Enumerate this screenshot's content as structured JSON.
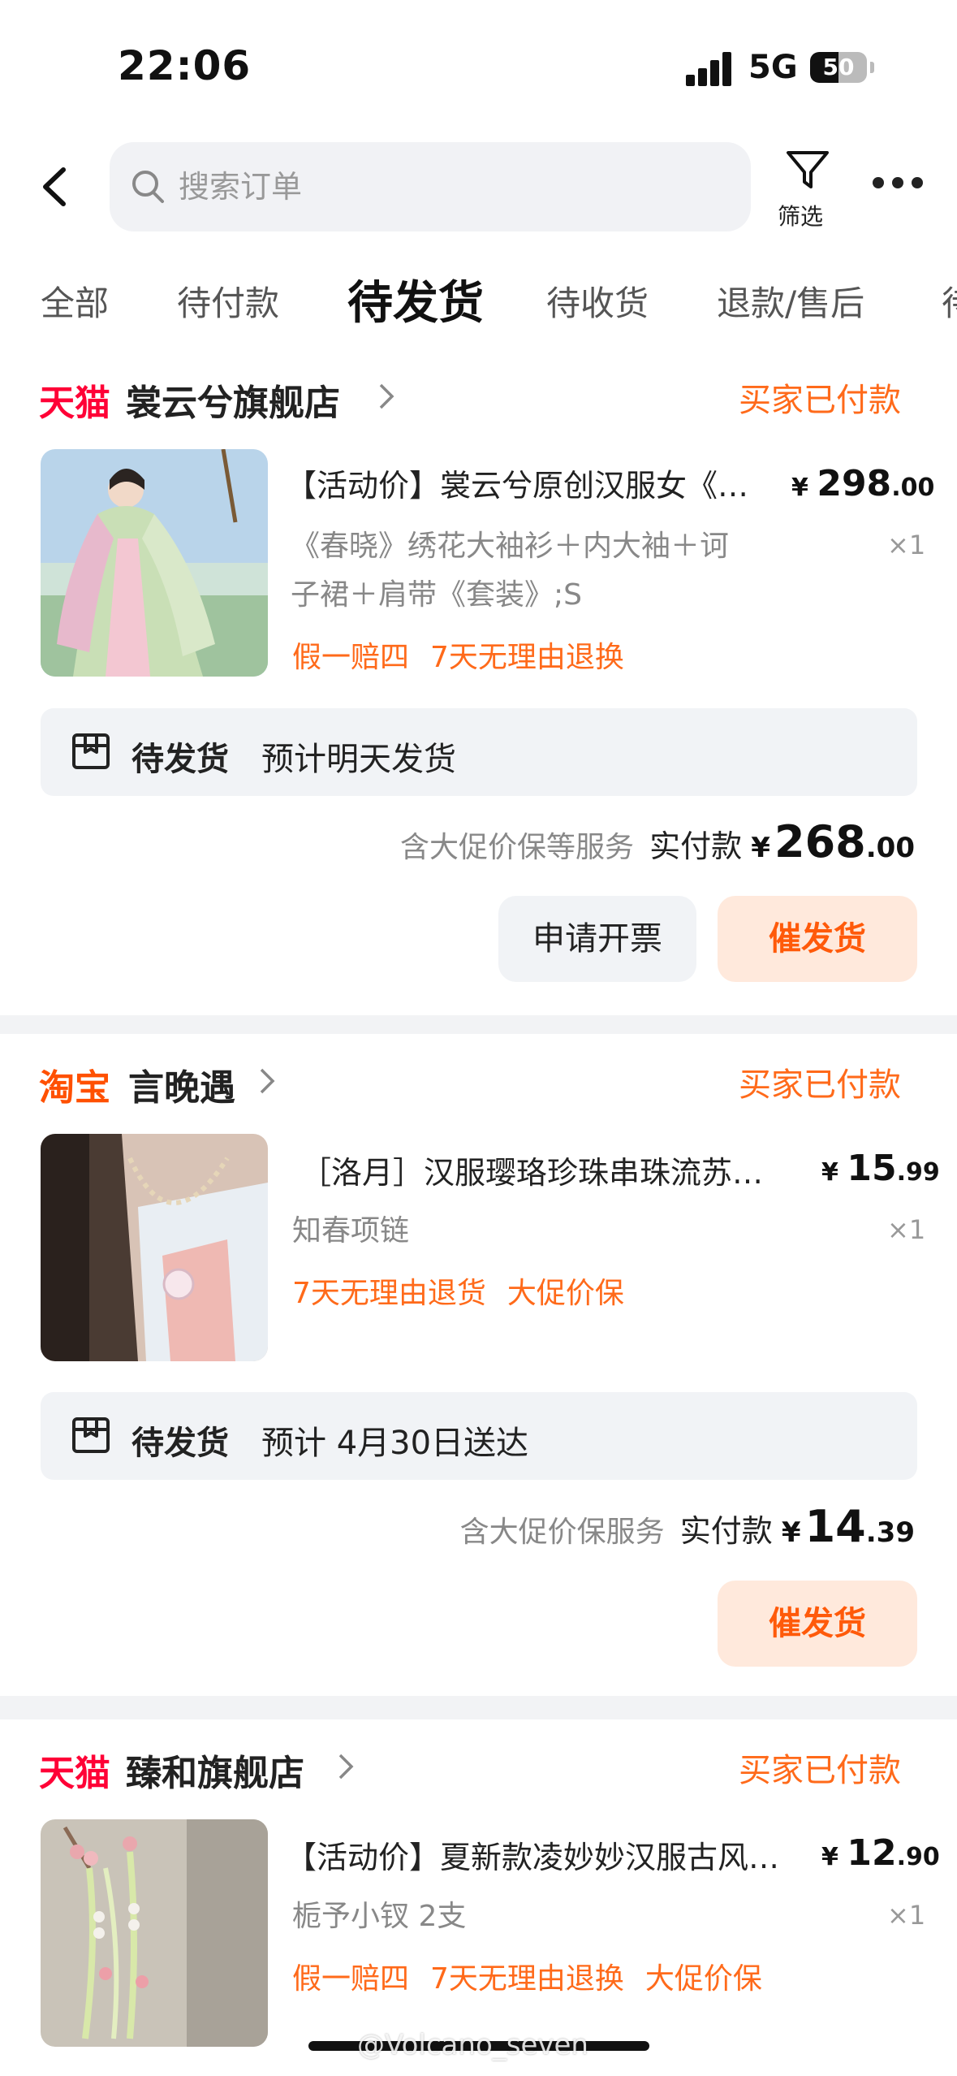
{
  "status_bar": {
    "time": "22:06",
    "network": "5G",
    "battery": "50"
  },
  "header": {
    "search_placeholder": "搜索订单",
    "filter_label": "筛选"
  },
  "tabs": [
    "全部",
    "待付款",
    "待发货",
    "待收货",
    "退款/售后",
    "待"
  ],
  "active_tab": "待发货",
  "orders": [
    {
      "platform": "天猫",
      "store": "裳云兮旗舰店",
      "status": "买家已付款",
      "title": "【活动价】裳云兮原创汉服女《…",
      "price_yen": "¥",
      "price_int": "298",
      "price_dec": ".00",
      "sku_line1": "《春晓》绣花大袖衫＋内大袖＋诃",
      "sku_line2": "子裙＋肩带《套装》;S",
      "qty": "×1",
      "tags": [
        "假一赔四",
        "7天无理由退换"
      ],
      "ship_status": "待发货",
      "ship_estimate": "预计明天发货",
      "service_note": "含大促价保等服务",
      "paid_label": "实付款",
      "paid_yen": "¥",
      "paid_int": "268",
      "paid_dec": ".00",
      "btn_invoice": "申请开票",
      "btn_urge": "催发货"
    },
    {
      "platform": "淘宝",
      "store": "言晚遇",
      "status": "买家已付款",
      "title": "［洛月］汉服璎珞珍珠串珠流苏…",
      "price_yen": "¥",
      "price_int": "15",
      "price_dec": ".99",
      "sku_line1": "知春项链",
      "qty": "×1",
      "tags": [
        "7天无理由退货",
        "大促价保"
      ],
      "ship_status": "待发货",
      "ship_estimate": "预计 4月30日送达",
      "service_note": "含大促价保服务",
      "paid_label": "实付款",
      "paid_yen": "¥",
      "paid_int": "14",
      "paid_dec": ".39",
      "btn_urge": "催发货"
    },
    {
      "platform": "天猫",
      "store": "臻和旗舰店",
      "status": "买家已付款",
      "title": "【活动价】夏新款凌妙妙汉服古风…",
      "price_yen": "¥",
      "price_int": "12",
      "price_dec": ".90",
      "sku_line1": "栀予小钗 2支",
      "qty": "×1",
      "tags": [
        "假一赔四",
        "7天无理由退换",
        "大促价保"
      ]
    }
  ],
  "watermark": "@Volcano_seven",
  "colors": {
    "accent_orange": "#ff6a1a",
    "tmall_red": "#ff0036",
    "taobao_orange": "#ff5000"
  }
}
